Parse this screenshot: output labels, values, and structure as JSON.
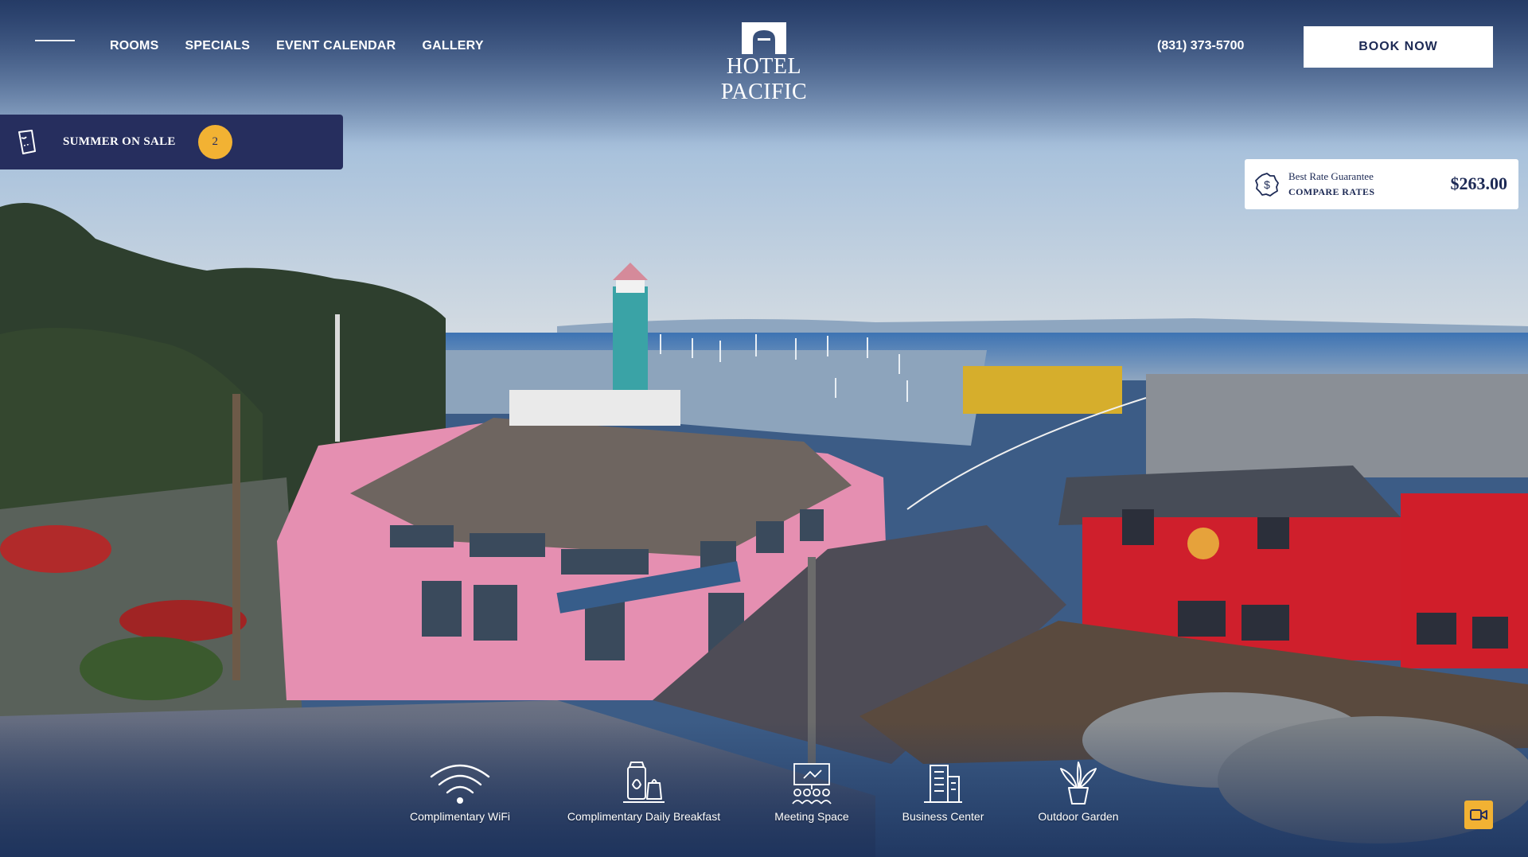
{
  "brand": {
    "name": "HOTEL PACIFIC"
  },
  "nav": {
    "menu_icon": "hamburger-icon",
    "items": [
      {
        "label": "ROOMS"
      },
      {
        "label": "SPECIALS"
      },
      {
        "label": "EVENT CALENDAR"
      },
      {
        "label": "GALLERY"
      }
    ]
  },
  "header": {
    "phone": "(831) 373-5700",
    "book_label": "BOOK NOW"
  },
  "promo": {
    "icon": "ticket-icon",
    "label": "SUMMER ON SALE",
    "count": "2"
  },
  "rate": {
    "icon": "dollar-badge-icon",
    "title": "Best Rate Guarantee",
    "link": "COMPARE RATES",
    "price": "$263.00"
  },
  "amenities": [
    {
      "icon": "wifi-icon",
      "label": "Complimentary WiFi"
    },
    {
      "icon": "breakfast-icon",
      "label": "Complimentary Daily Breakfast"
    },
    {
      "icon": "meeting-icon",
      "label": "Meeting Space"
    },
    {
      "icon": "building-icon",
      "label": "Business Center"
    },
    {
      "icon": "plant-icon",
      "label": "Outdoor Garden"
    }
  ],
  "video": {
    "icon": "video-camera-icon"
  },
  "colors": {
    "navy": "#262e5e",
    "accent_yellow": "#f2b233",
    "white": "#ffffff"
  }
}
